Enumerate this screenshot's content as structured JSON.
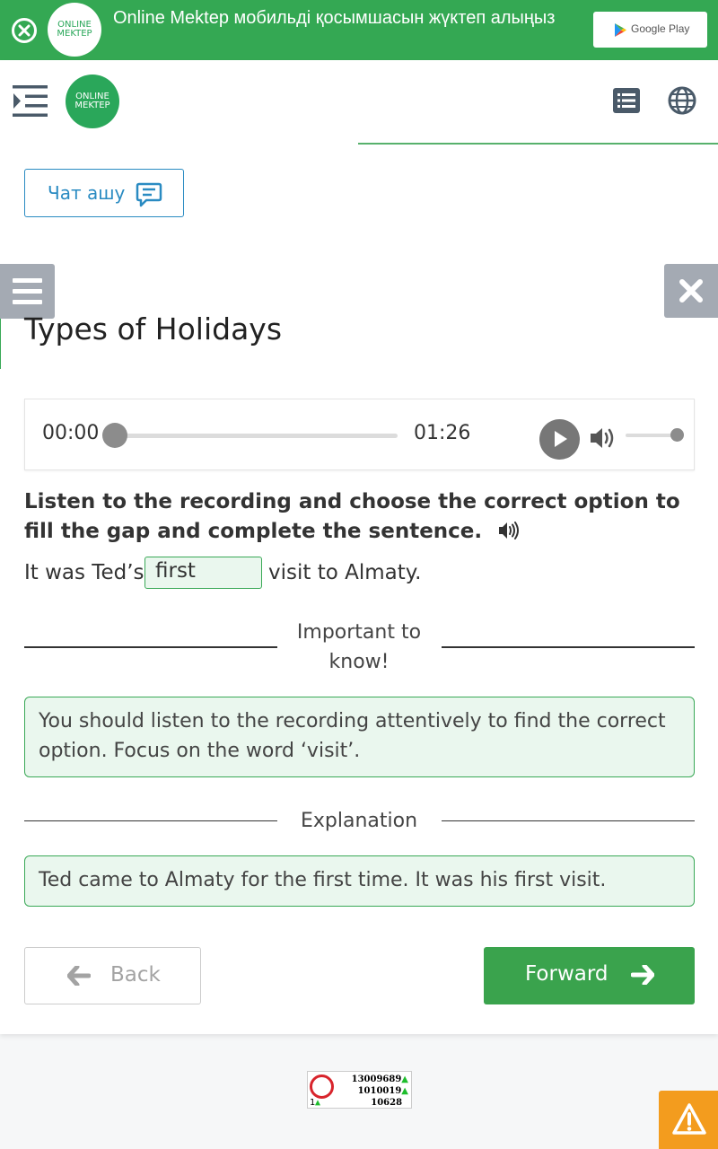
{
  "banner": {
    "logo_text_1": "ONLINE",
    "logo_text_2": "MEKTEP",
    "text": "Online Mektep мобильді қосымшасын жүктеп алыңыз",
    "store_label": "Google Play"
  },
  "header": {
    "logo_text_1": "ONLINE",
    "logo_text_2": "MEKTEP"
  },
  "chat": {
    "label": "Чат ашу"
  },
  "lesson": {
    "title": "Types of Holidays"
  },
  "audio": {
    "current_time": "00:00",
    "duration": "01:26",
    "progress": 0,
    "volume": 1
  },
  "task": {
    "instruction": "Listen to the recording and choose the correct option to fill the gap and complete the sentence."
  },
  "sentence": {
    "before": "It was Ted’s",
    "answer": "first",
    "after": "visit to Almaty."
  },
  "important": {
    "heading_line1": "Important to",
    "heading_line2": "know!",
    "text": "You should listen to the recording attentively to find the correct option. Focus on the word ‘visit’."
  },
  "explanation": {
    "heading": "Explanation",
    "text": "Ted came to Almaty for the first time. It was his first visit."
  },
  "nav": {
    "back_label": "Back",
    "forward_label": "Forward"
  },
  "counter": {
    "left_value": "1",
    "line1": "13009689",
    "line2": "1010019",
    "line3": "10628"
  },
  "colors": {
    "brand_green": "#34a853",
    "button_green": "#3aa34d",
    "link_blue": "#2a8bc2",
    "alert_orange": "#f39c1e"
  },
  "icons": {
    "banner_close": "close-circle-icon",
    "menu_toggle": "indent-icon",
    "list": "list-icon",
    "language": "globe-icon",
    "chat": "chat-icon",
    "side_menu": "hamburger-icon",
    "side_close": "close-icon",
    "play": "play-icon",
    "volume": "volume-icon",
    "listen": "speaker-icon",
    "back": "arrow-left-icon",
    "forward": "arrow-right-icon",
    "alert": "warning-icon"
  }
}
